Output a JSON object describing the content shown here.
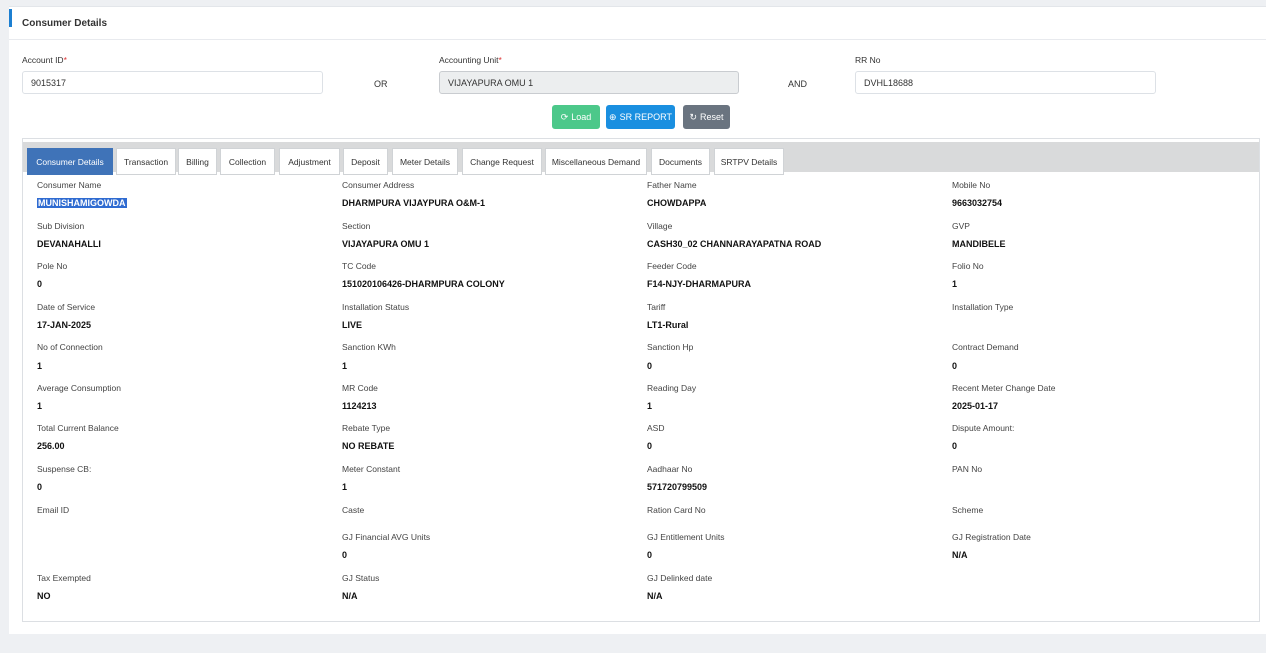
{
  "header": {
    "title": "Consumer Details"
  },
  "search": {
    "account_id_label": "Account ID",
    "account_id_value": "9015317",
    "or_text": "OR",
    "accounting_unit_label": "Accounting Unit",
    "accounting_unit_value": "VIJAYAPURA OMU 1",
    "and_text": "AND",
    "rr_no_label": "RR No",
    "rr_no_value": "DVHL18688",
    "required_marker": "*"
  },
  "buttons": {
    "load": "Load",
    "sr_report": "SR REPORT",
    "reset": "Reset"
  },
  "tabs": [
    "Consumer Details",
    "Transaction",
    "Billing",
    "Collection",
    "Adjustment",
    "Deposit",
    "Meter Details",
    "Change Request",
    "Miscellaneous Demand",
    "Documents",
    "SRTPV Details"
  ],
  "details": {
    "consumer_name": {
      "label": "Consumer Name",
      "value": "MUNISHAMIGOWDA"
    },
    "consumer_address": {
      "label": "Consumer Address",
      "value": "DHARMPURA VIJAYPURA O&M-1"
    },
    "father_name": {
      "label": "Father Name",
      "value": "CHOWDAPPA"
    },
    "mobile_no": {
      "label": "Mobile No",
      "value": "9663032754"
    },
    "sub_division": {
      "label": "Sub Division",
      "value": "DEVANAHALLI"
    },
    "section": {
      "label": "Section",
      "value": "VIJAYAPURA OMU 1"
    },
    "village": {
      "label": "Village",
      "value": "CASH30_02 CHANNARAYAPATNA ROAD"
    },
    "gvp": {
      "label": "GVP",
      "value": "MANDIBELE"
    },
    "pole_no": {
      "label": "Pole No",
      "value": "0"
    },
    "tc_code": {
      "label": "TC Code",
      "value": "151020106426-DHARMPURA COLONY"
    },
    "feeder_code": {
      "label": "Feeder Code",
      "value": "F14-NJY-DHARMAPURA"
    },
    "folio_no": {
      "label": "Folio No",
      "value": "1"
    },
    "date_of_service": {
      "label": "Date of Service",
      "value": "17-JAN-2025"
    },
    "installation_status": {
      "label": "Installation Status",
      "value": "LIVE"
    },
    "tariff": {
      "label": "Tariff",
      "value": "LT1-Rural"
    },
    "installation_type": {
      "label": "Installation Type",
      "value": ""
    },
    "no_of_connection": {
      "label": "No of Connection",
      "value": "1"
    },
    "sanction_kwh": {
      "label": "Sanction KWh",
      "value": "1"
    },
    "sanction_hp": {
      "label": "Sanction Hp",
      "value": "0"
    },
    "contract_demand": {
      "label": "Contract Demand",
      "value": "0"
    },
    "average_consumption": {
      "label": "Average Consumption",
      "value": "1"
    },
    "mr_code": {
      "label": "MR Code",
      "value": "1124213"
    },
    "reading_day": {
      "label": "Reading Day",
      "value": "1"
    },
    "recent_meter_change_date": {
      "label": "Recent Meter Change Date",
      "value": "2025-01-17"
    },
    "total_current_balance": {
      "label": "Total Current Balance",
      "value": "256.00"
    },
    "rebate_type": {
      "label": "Rebate Type",
      "value": "NO REBATE"
    },
    "asd": {
      "label": "ASD",
      "value": "0"
    },
    "dispute_amount": {
      "label": "Dispute Amount:",
      "value": "0"
    },
    "suspense_cb": {
      "label": "Suspense CB:",
      "value": "0"
    },
    "meter_constant": {
      "label": "Meter Constant",
      "value": "1"
    },
    "aadhaar_no": {
      "label": "Aadhaar No",
      "value": "571720799509"
    },
    "pan_no": {
      "label": "PAN No",
      "value": ""
    },
    "email_id": {
      "label": "Email ID",
      "value": ""
    },
    "caste": {
      "label": "Caste",
      "value": ""
    },
    "ration_card_no": {
      "label": "Ration Card No",
      "value": ""
    },
    "scheme": {
      "label": "Scheme",
      "value": ""
    },
    "gj_financial_avg_units": {
      "label": "GJ Financial AVG Units",
      "value": "0"
    },
    "gj_entitlement_units": {
      "label": "GJ Entitlement Units",
      "value": "0"
    },
    "gj_registration_date": {
      "label": "GJ Registration Date",
      "value": "N/A"
    },
    "tax_exempted": {
      "label": "Tax Exempted",
      "value": "NO"
    },
    "gj_status": {
      "label": "GJ Status",
      "value": "N/A"
    },
    "gj_delinked_date": {
      "label": "GJ Delinked date",
      "value": "N/A"
    }
  },
  "colors": {
    "accent": "#1c7fd1",
    "active_tab": "#3f73b8",
    "load_button": "#4cc88a",
    "sr_button": "#1a8fe0",
    "reset_button": "#6a7480"
  }
}
